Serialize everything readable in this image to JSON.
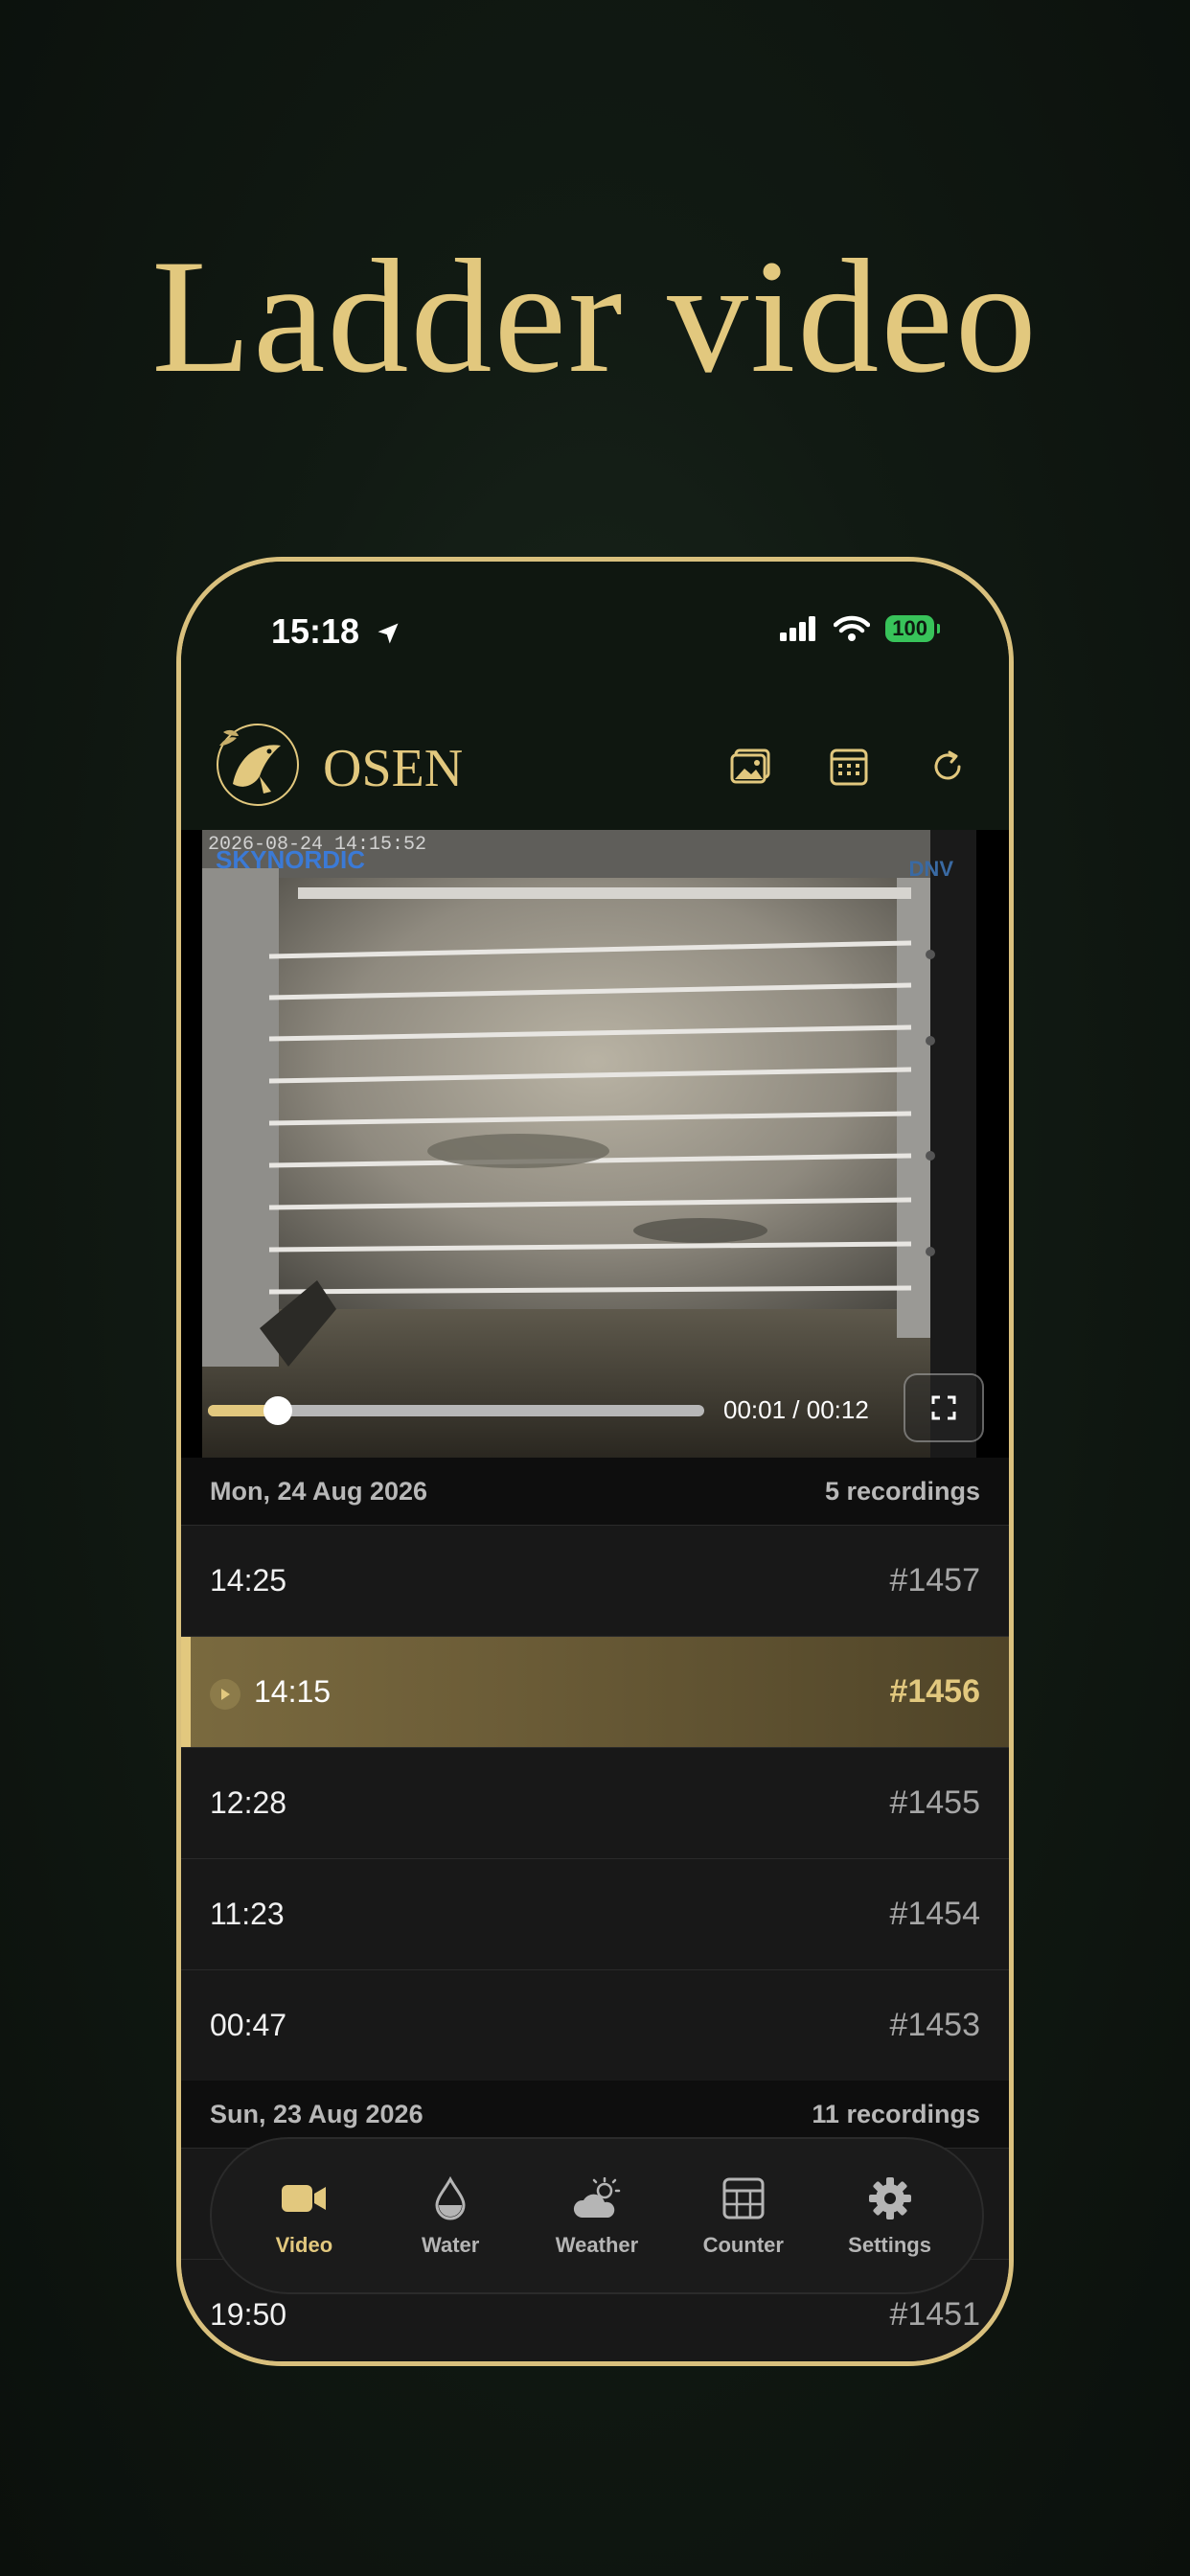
{
  "headline": "Ladder video",
  "status_bar": {
    "time": "15:18",
    "battery": "100"
  },
  "app": {
    "brand": "OSEN",
    "icons": [
      "gallery-icon",
      "calendar-icon",
      "refresh-icon"
    ]
  },
  "video": {
    "osd_timestamp": "2026-08-24 14:15:52",
    "osd_brand": "SKYNORDIC",
    "osd_partner": "DNV",
    "time_display": "00:01 / 00:12",
    "progress": 0.14
  },
  "groups": [
    {
      "date": "Mon, 24 Aug 2026",
      "count_label": "5 recordings",
      "rows": [
        {
          "time": "14:25",
          "id": "#1457",
          "active": false
        },
        {
          "time": "14:15",
          "id": "#1456",
          "active": true
        },
        {
          "time": "12:28",
          "id": "#1455",
          "active": false
        },
        {
          "time": "11:23",
          "id": "#1454",
          "active": false
        },
        {
          "time": "00:47",
          "id": "#1453",
          "active": false
        }
      ]
    },
    {
      "date": "Sun, 23 Aug 2026",
      "count_label": "11 recordings",
      "rows": [
        {
          "time": "19:50",
          "id": "#1451",
          "active": false
        }
      ]
    }
  ],
  "tabs": [
    {
      "label": "Video",
      "icon": "video-camera-icon",
      "active": true
    },
    {
      "label": "Water",
      "icon": "water-drop-icon",
      "active": false
    },
    {
      "label": "Weather",
      "icon": "weather-icon",
      "active": false
    },
    {
      "label": "Counter",
      "icon": "table-grid-icon",
      "active": false
    },
    {
      "label": "Settings",
      "icon": "gear-icon",
      "active": false
    }
  ],
  "colors": {
    "accent": "#e2c87e",
    "background": "#0f1710",
    "row": "#181818"
  }
}
